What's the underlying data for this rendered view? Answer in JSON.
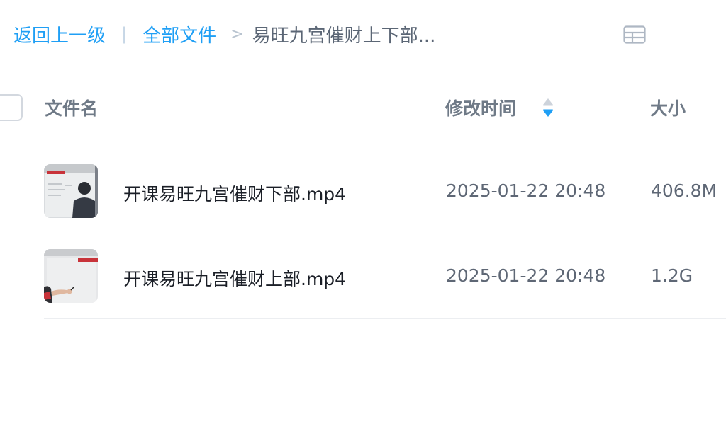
{
  "breadcrumb": {
    "back_label": "返回上一级",
    "divider": "|",
    "all_files_label": "全部文件",
    "separator": ">",
    "current_folder": "易旺九宫催财上下部..."
  },
  "view_toggle": {
    "icon": "grid-view-icon"
  },
  "table": {
    "columns": {
      "name": "文件名",
      "modified": "修改时间",
      "size": "大小"
    },
    "sort": {
      "column": "modified",
      "direction": "descending",
      "icon": "sort-icon"
    },
    "rows": [
      {
        "name": "开课易旺九宫催财下部.mp4",
        "modified": "2025-01-22 20:48",
        "size": "406.8M",
        "thumbnail": "video-thumbnail"
      },
      {
        "name": "开课易旺九宫催财上部.mp4",
        "modified": "2025-01-22 20:48",
        "size": "1.2G",
        "thumbnail": "video-thumbnail"
      }
    ]
  },
  "colors": {
    "link": "#1f9ff5",
    "sort_active": "#1f9ff5",
    "header_text": "#6f7a87",
    "body_text": "#1b1f27",
    "muted_text": "#5e6775"
  }
}
